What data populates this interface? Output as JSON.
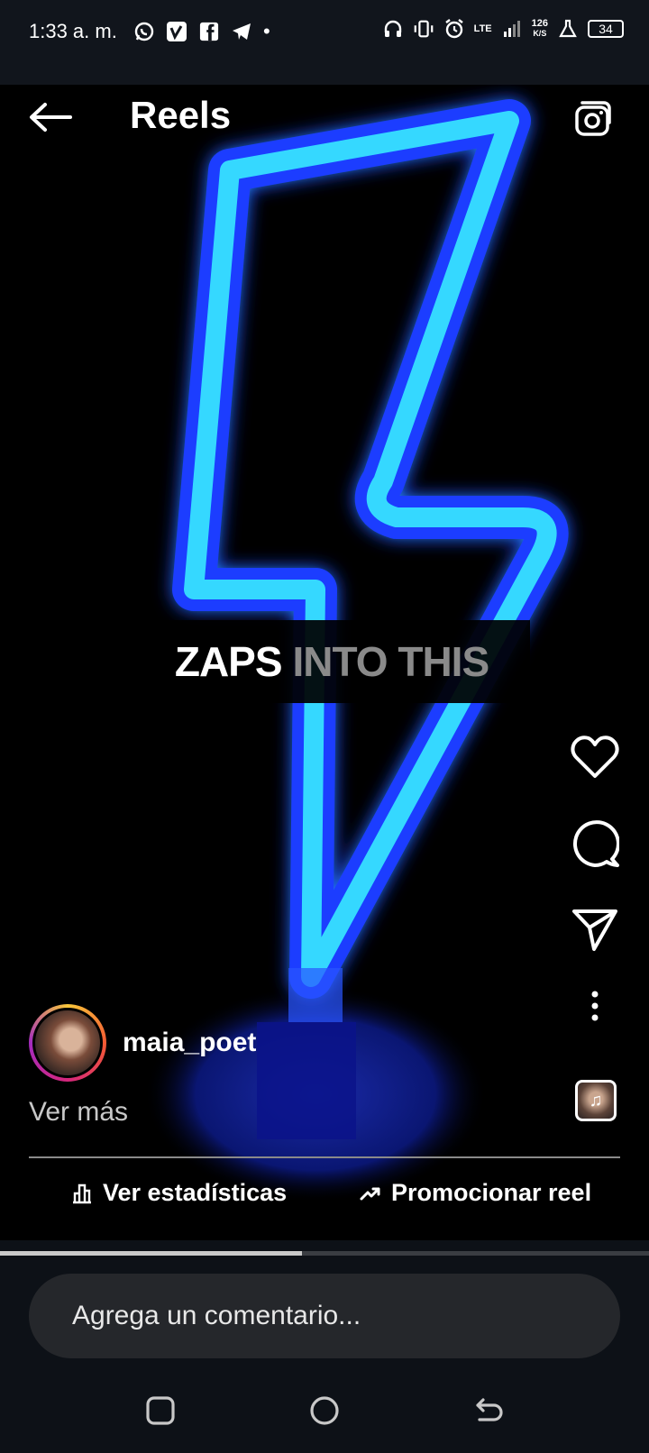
{
  "status_bar": {
    "time": "1:33 a. m.",
    "network": "LTE",
    "speed_value": "126",
    "speed_unit": "K/S",
    "battery": "34"
  },
  "header": {
    "title": "Reels"
  },
  "reel": {
    "caption_strong": "ZAPS",
    "caption_dim": "INTO THIS",
    "author": "maia_poet",
    "see_more": "Ver más",
    "insights_label": "Ver estadísticas",
    "promote_label": "Promocionar reel",
    "progress": 0.465
  },
  "comment": {
    "placeholder": "Agrega un comentario..."
  },
  "icons": [
    "back-arrow-icon",
    "camera-icon",
    "heart-icon",
    "comment-icon",
    "send-icon",
    "more-icon",
    "music-icon",
    "bar-chart-icon",
    "trend-up-icon",
    "recents-icon",
    "home-icon",
    "back-icon"
  ],
  "colors": {
    "neon_blue": "#2fd0ff",
    "background": "#000000",
    "input_bg": "#25272b"
  }
}
